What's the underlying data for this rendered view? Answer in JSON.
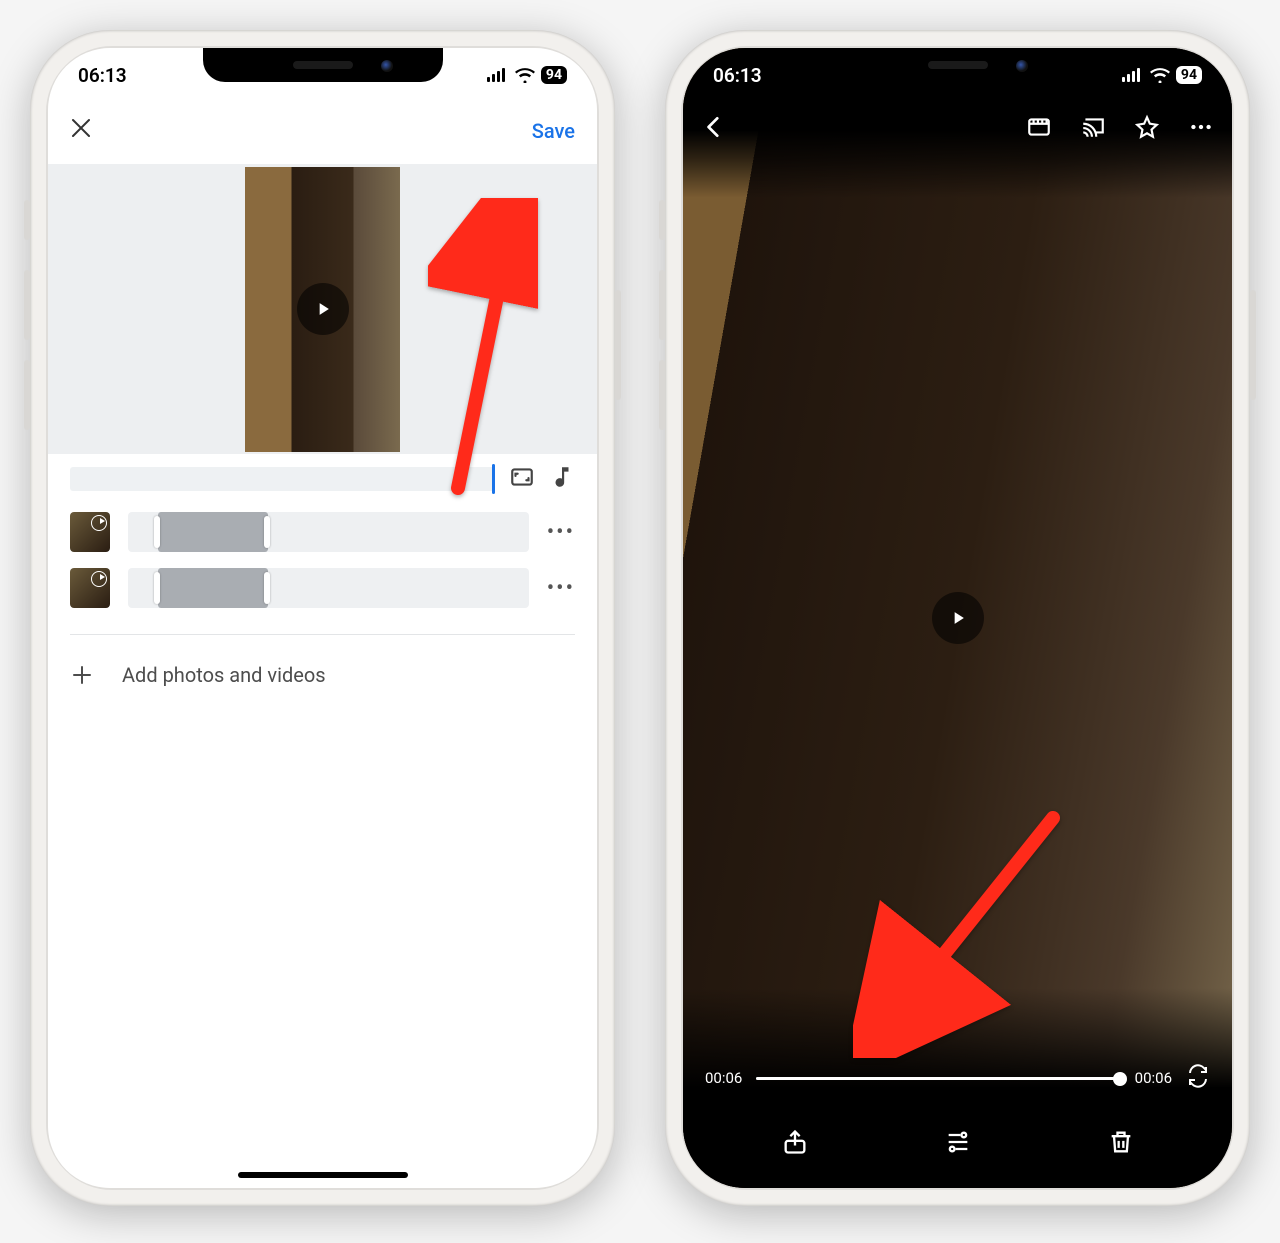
{
  "status": {
    "time": "06:13",
    "battery": "94"
  },
  "left": {
    "save_label": "Save",
    "add_label": "Add photos and videos"
  },
  "right": {
    "current_time": "00:06",
    "total_time": "00:06"
  }
}
